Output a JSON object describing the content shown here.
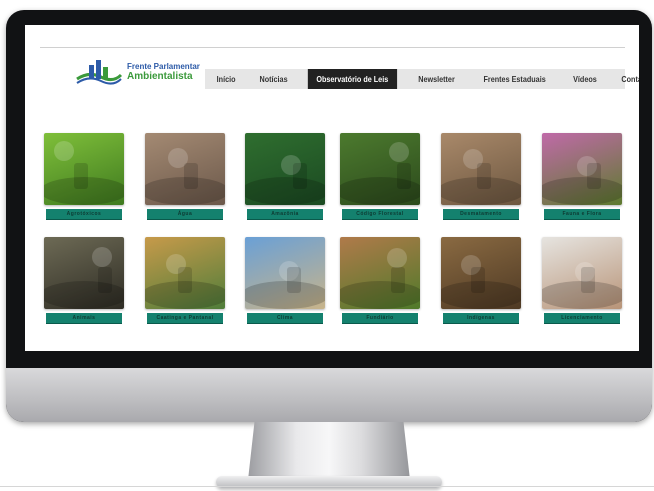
{
  "logo": {
    "line1": "Frente Parlamentar",
    "line2": "Ambientalista"
  },
  "nav": [
    "Início",
    "Notícias",
    "Observatório de Leis",
    "Newsletter",
    "Frentes Estaduais",
    "Vídeos",
    "Contato"
  ],
  "nav_active_index": 2,
  "tiles": [
    {
      "label": "Agrotóxicos",
      "icon": "crop-field-image",
      "bg": [
        "#7fbf3a",
        "#3f7a1f"
      ]
    },
    {
      "label": "Água",
      "icon": "hands-cracked-earth-image",
      "bg": [
        "#a48a73",
        "#6b584a"
      ]
    },
    {
      "label": "Amazônia",
      "icon": "river-forest-image",
      "bg": [
        "#2f6e2f",
        "#1b4a22"
      ]
    },
    {
      "label": "Código Florestal",
      "icon": "forest-image",
      "bg": [
        "#4c7a2e",
        "#2c4a1c"
      ]
    },
    {
      "label": "Desmatamento",
      "icon": "cut-logs-image",
      "bg": [
        "#a9896a",
        "#6d5740"
      ]
    },
    {
      "label": "Fauna e Flora",
      "icon": "hummingbird-flower-image",
      "bg": [
        "#c06aa8",
        "#5d7a2e"
      ]
    },
    {
      "label": "Animais",
      "icon": "jaguar-image",
      "bg": [
        "#6d6a55",
        "#2e2c24"
      ]
    },
    {
      "label": "Caatinga e Pantanal",
      "icon": "wetland-cactus-image",
      "bg": [
        "#c79a4a",
        "#4f7d3a"
      ]
    },
    {
      "label": "Clima",
      "icon": "tree-climate-image",
      "bg": [
        "#6aa0d6",
        "#c8b48a"
      ]
    },
    {
      "label": "Fundiário",
      "icon": "farmland-image",
      "bg": [
        "#b07a4a",
        "#4f7a2a"
      ]
    },
    {
      "label": "Indígenas",
      "icon": "indigenous-person-image",
      "bg": [
        "#8a6a42",
        "#4f3a24"
      ]
    },
    {
      "label": "Licenciamento",
      "icon": "clipboard-writing-image",
      "bg": [
        "#e6e4e0",
        "#b89478"
      ]
    }
  ]
}
